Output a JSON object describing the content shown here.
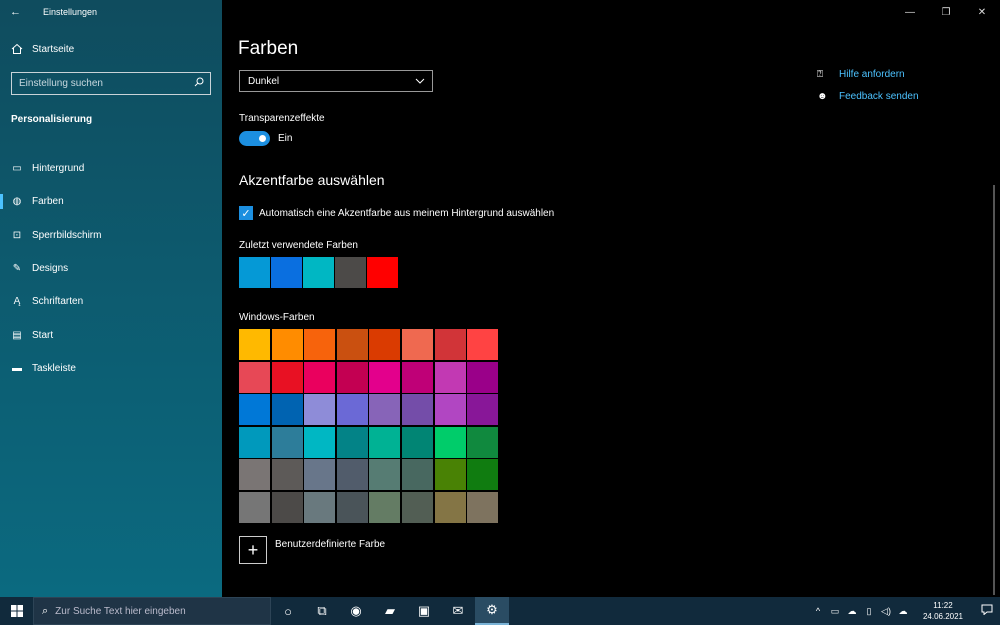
{
  "window": {
    "title": "Einstellungen",
    "controls": {
      "minimize": "—",
      "maximize": "❐",
      "close": "✕"
    }
  },
  "sidebar": {
    "home_label": "Startseite",
    "search_placeholder": "Einstellung suchen",
    "section_title": "Personalisierung",
    "items": [
      {
        "label": "Hintergrund",
        "icon": "picture-icon",
        "glyph": "▭",
        "active": false
      },
      {
        "label": "Farben",
        "icon": "palette-icon",
        "glyph": "◍",
        "active": true
      },
      {
        "label": "Sperrbildschirm",
        "icon": "lockscreen-icon",
        "glyph": "⊡",
        "active": false
      },
      {
        "label": "Designs",
        "icon": "brush-icon",
        "glyph": "✎",
        "active": false
      },
      {
        "label": "Schriftarten",
        "icon": "font-icon",
        "glyph": "Ą",
        "active": false
      },
      {
        "label": "Start",
        "icon": "start-menu-icon",
        "glyph": "▤",
        "active": false
      },
      {
        "label": "Taskleiste",
        "icon": "taskbar-icon",
        "glyph": "▬",
        "active": false
      }
    ]
  },
  "main": {
    "title": "Farben",
    "mode_dropdown": {
      "value": "Dunkel"
    },
    "transparency": {
      "label": "Transparenzeffekte",
      "state_label": "Ein",
      "on": true
    },
    "accent": {
      "title": "Akzentfarbe auswählen",
      "auto_checkbox_label": "Automatisch eine Akzentfarbe aus meinem Hintergrund auswählen",
      "auto_checked": true,
      "recent_label": "Zuletzt verwendete Farben",
      "recent_colors": [
        "#0599d6",
        "#0a6fe0",
        "#00b7c3",
        "#4c4a48",
        "#ff0000"
      ],
      "windows_label": "Windows-Farben",
      "windows_colors": [
        "#ffb900",
        "#ff8c00",
        "#f7630c",
        "#ca5010",
        "#da3b01",
        "#ef6950",
        "#d13438",
        "#ff4343",
        "#e74856",
        "#e81123",
        "#ea005e",
        "#c30052",
        "#e3008c",
        "#bf0077",
        "#c239b3",
        "#9a0089",
        "#0078d7",
        "#0063b1",
        "#8e8cd8",
        "#6b69d6",
        "#8764b8",
        "#744da9",
        "#b146c2",
        "#881798",
        "#0099bc",
        "#2d7d9a",
        "#00b7c3",
        "#038387",
        "#00b294",
        "#018574",
        "#00cc6a",
        "#10893e",
        "#7a7574",
        "#5d5a58",
        "#68768a",
        "#515c6b",
        "#567c73",
        "#486860",
        "#498205",
        "#107c10",
        "#767676",
        "#4c4a48",
        "#69797e",
        "#4a5459",
        "#647c64",
        "#525e54",
        "#847545",
        "#7e735f"
      ],
      "custom_label": "Benutzerdefinierte Farbe"
    },
    "links": [
      {
        "label": "Hilfe anfordern",
        "icon": "help-chat-icon",
        "glyph": "⍰"
      },
      {
        "label": "Feedback senden",
        "icon": "feedback-icon",
        "glyph": "☻"
      }
    ]
  },
  "taskbar": {
    "search_placeholder": "Zur Suche Text hier eingeben",
    "apps": [
      {
        "name": "cortana-icon",
        "glyph": "○",
        "active": false
      },
      {
        "name": "task-view-icon",
        "glyph": "⧉",
        "active": false
      },
      {
        "name": "edge-icon",
        "glyph": "◉",
        "active": false
      },
      {
        "name": "file-explorer-icon",
        "glyph": "▰",
        "active": false
      },
      {
        "name": "store-icon",
        "glyph": "▣",
        "active": false
      },
      {
        "name": "mail-icon",
        "glyph": "✉",
        "active": false
      },
      {
        "name": "settings-icon",
        "glyph": "⚙",
        "active": true
      }
    ],
    "tray": [
      "^",
      "▭",
      "☁",
      "▯",
      "◁)",
      "☁"
    ],
    "time": "11:22",
    "date": "24.06.2021"
  }
}
